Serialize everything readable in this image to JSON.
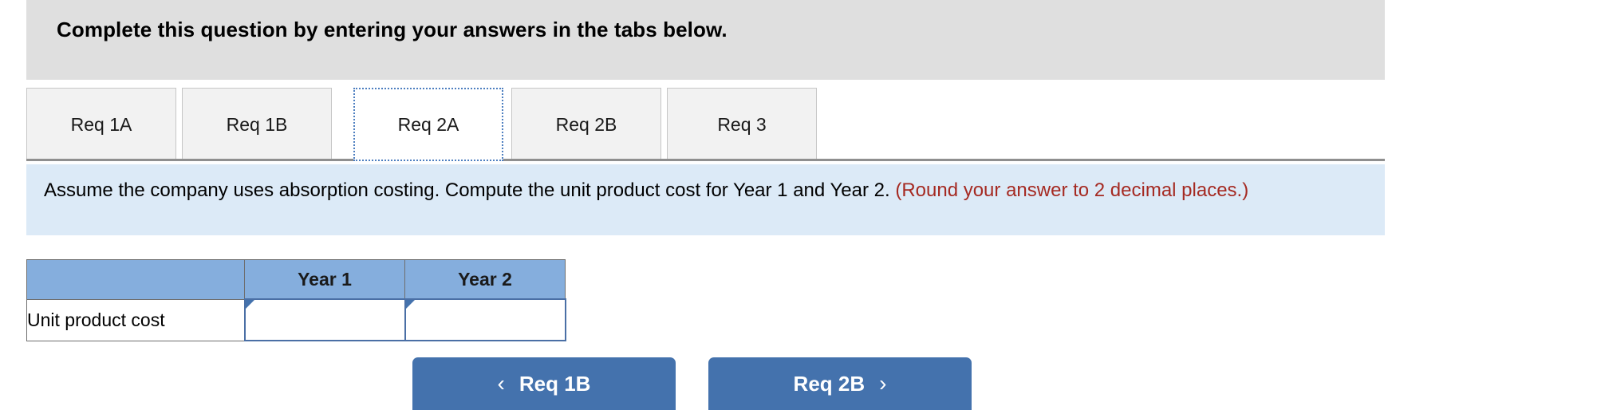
{
  "header": {
    "banner_text": "Complete this question by entering your answers in the tabs below.",
    "background_color": "#dfdfdf"
  },
  "tabs": {
    "active_index": 2,
    "items": [
      {
        "label": "Req 1A",
        "active": false
      },
      {
        "label": "Req 1B",
        "active": false
      },
      {
        "label": "Req 2A",
        "active": true
      },
      {
        "label": "Req 2B",
        "active": false
      },
      {
        "label": "Req 3",
        "active": false
      }
    ]
  },
  "instruction": {
    "main_text": "Assume the company uses absorption costing. Compute the unit product cost for Year 1 and Year 2. ",
    "hint_text": "(Round your answer to 2 decimal places.)",
    "background_color": "#dceaf7",
    "hint_color": "#a52a22"
  },
  "answer_table": {
    "header_color": "#85aedd",
    "columns": [
      "",
      "Year 1",
      "Year 2"
    ],
    "rows": [
      {
        "label": "Unit product cost",
        "values": [
          "",
          ""
        ],
        "placeholders": [
          "",
          ""
        ]
      }
    ]
  },
  "footer": {
    "prev_button": {
      "label": "Req 1B",
      "icon": "chevron-left-icon",
      "glyph": "‹"
    },
    "next_button": {
      "label": "Req 2B",
      "icon": "chevron-right-icon",
      "glyph": "›"
    },
    "button_color": "#4472ad"
  }
}
